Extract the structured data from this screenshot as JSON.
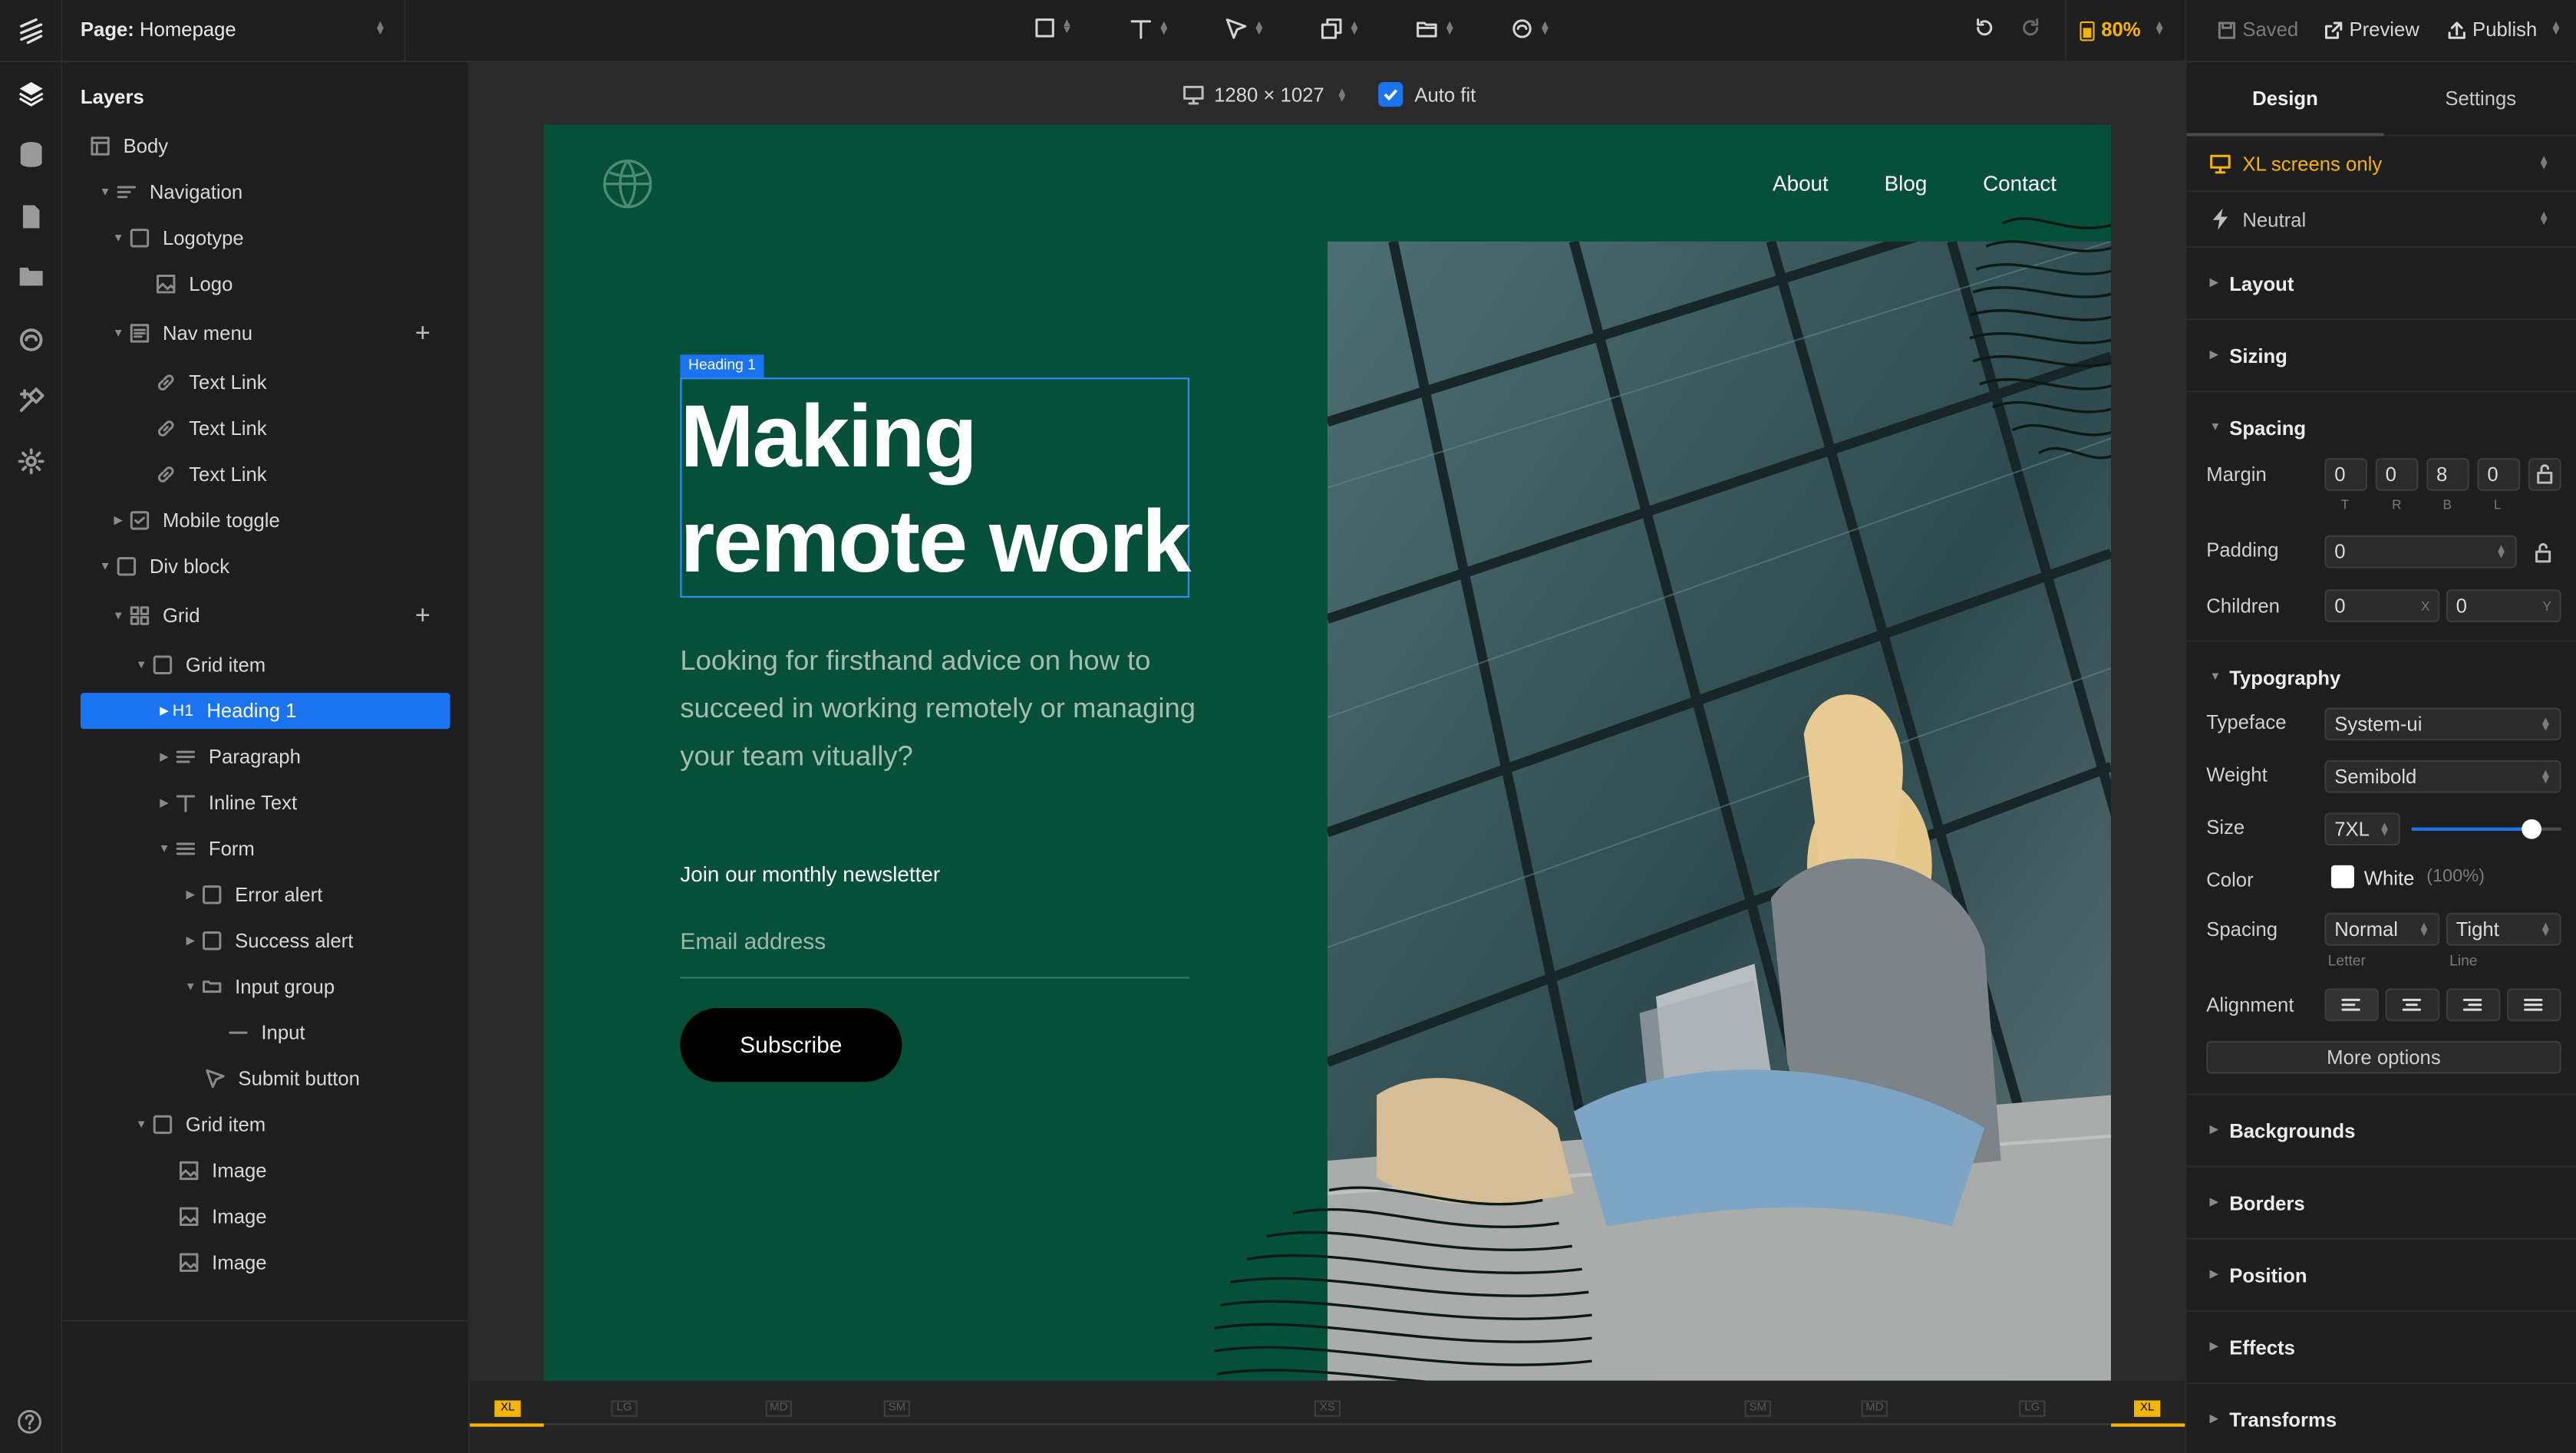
{
  "topbar": {
    "page_prefix": "Page:",
    "page_name": "Homepage",
    "zoom": "80%",
    "saved": "Saved",
    "preview": "Preview",
    "publish": "Publish",
    "accent": "#f5b400"
  },
  "layers": {
    "title": "Layers",
    "items": [
      {
        "label": "Body"
      },
      {
        "label": "Navigation"
      },
      {
        "label": "Logotype"
      },
      {
        "label": "Logo"
      },
      {
        "label": "Nav menu"
      },
      {
        "label": "Text Link"
      },
      {
        "label": "Text Link"
      },
      {
        "label": "Text Link"
      },
      {
        "label": "Mobile toggle"
      },
      {
        "label": "Div block"
      },
      {
        "label": "Grid"
      },
      {
        "label": "Grid item"
      },
      {
        "tag": "H1",
        "label": "Heading 1"
      },
      {
        "label": "Paragraph"
      },
      {
        "label": "Inline Text"
      },
      {
        "label": "Form"
      },
      {
        "label": "Error alert"
      },
      {
        "label": "Success alert"
      },
      {
        "label": "Input group"
      },
      {
        "label": "Input"
      },
      {
        "label": "Submit button"
      },
      {
        "label": "Grid item"
      },
      {
        "label": "Image"
      },
      {
        "label": "Image"
      },
      {
        "label": "Image"
      }
    ],
    "selection_color": "#1a73f0"
  },
  "canvas": {
    "viewport_size": "1280 × 1027",
    "auto_fit_label": "Auto fit",
    "auto_fit_checked": true,
    "site": {
      "bg_color": "#06503a",
      "nav_links": [
        "About",
        "Blog",
        "Contact"
      ],
      "selection_tag": "Heading 1",
      "heading_line1": "Making",
      "heading_line2": "remote work",
      "paragraph": "Looking for firsthand advice on how to succeed in working remotely or managing your team vitually?",
      "newsletter_label": "Join our monthly newsletter",
      "email_placeholder": "Email address",
      "subscribe_label": "Subscribe"
    },
    "breakpoints": [
      "XL",
      "LG",
      "MD",
      "SM",
      "XS",
      "SM",
      "MD",
      "LG",
      "XL"
    ]
  },
  "design_panel": {
    "tabs": [
      "Design",
      "Settings"
    ],
    "active_tab": "Design",
    "screens": "XL screens only",
    "state": "Neutral",
    "sections_top": [
      "Layout",
      "Sizing"
    ],
    "spacing": {
      "title": "Spacing",
      "margin_label": "Margin",
      "margin": [
        "0",
        "0",
        "8",
        "0"
      ],
      "margin_sides": [
        "T",
        "R",
        "B",
        "L"
      ],
      "padding_label": "Padding",
      "padding": "0",
      "children_label": "Children",
      "children_x": "0",
      "children_y": "0",
      "x_label": "X",
      "y_label": "Y"
    },
    "typography": {
      "title": "Typography",
      "typeface_label": "Typeface",
      "typeface": "System-ui",
      "weight_label": "Weight",
      "weight": "Semibold",
      "size_label": "Size",
      "size": "7XL",
      "size_slider_value": 0.8,
      "color_label": "Color",
      "color_name": "White",
      "color_opacity": "(100%)",
      "spacing_label": "Spacing",
      "letter": "Normal",
      "line": "Tight",
      "letter_caption": "Letter",
      "line_caption": "Line",
      "alignment_label": "Alignment",
      "more_options": "More options"
    },
    "sections_bottom": [
      "Backgrounds",
      "Borders",
      "Position",
      "Effects",
      "Transforms"
    ]
  }
}
